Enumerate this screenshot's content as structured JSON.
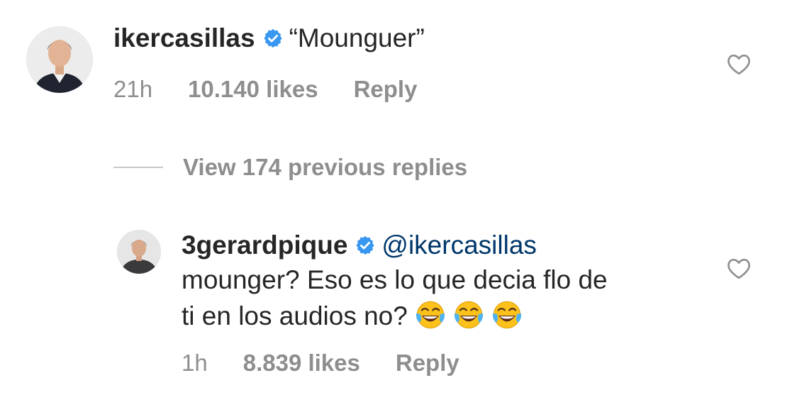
{
  "comment": {
    "username": "ikercasillas",
    "text": "“Mounguer”",
    "time": "21h",
    "likes": "10.140 likes",
    "reply_label": "Reply",
    "verified_icon": "verified-badge-icon",
    "like_icon": "heart-outline-icon"
  },
  "view_replies": {
    "label": "View 174 previous replies"
  },
  "reply": {
    "username": "3gerardpique",
    "mention": "@ikercasillas",
    "text_line1": "mounger? Eso es lo que decia flo de",
    "text_line2": "ti en los audios no?",
    "emojis": [
      "face-with-tears-of-joy",
      "face-with-tears-of-joy",
      "face-with-tears-of-joy"
    ],
    "time": "1h",
    "likes": "8.839 likes",
    "reply_label": "Reply",
    "verified_icon": "verified-badge-icon",
    "like_icon": "heart-outline-icon"
  },
  "colors": {
    "text": "#262626",
    "secondary": "#8e8e8e",
    "verified": "#3897f0",
    "mention": "#00376b",
    "divider": "#c7c7c7"
  }
}
